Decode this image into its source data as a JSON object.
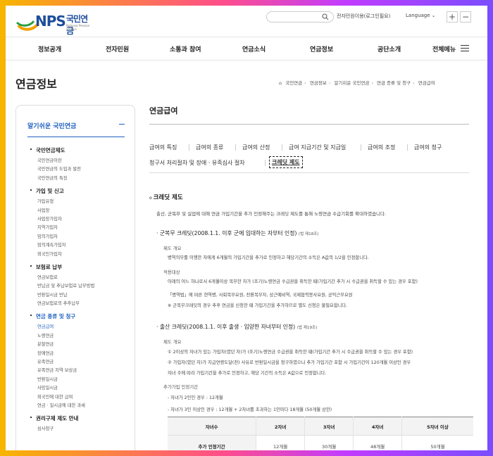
{
  "header": {
    "logo_mark": "NPS",
    "logo_ko": "국민연금",
    "logo_en": "National Pension Service",
    "search_placeholder": "",
    "util_link": "전자민원이용(로그인필요)",
    "language": "Language",
    "zoom_in": "+",
    "zoom_out": "−"
  },
  "gnb": [
    "정보공개",
    "전자민원",
    "소통과 참여",
    "연금소식",
    "연금정보",
    "공단소개",
    "전체메뉴"
  ],
  "page_title": "연금정보",
  "breadcrumb": [
    "국민연금",
    "연금정보",
    "알기쉬운 국민연금",
    "연금 종류 및 청구",
    "연금급여"
  ],
  "sidebar": {
    "head": "알기쉬운 국민연금",
    "groups": [
      {
        "label": "국민연금제도",
        "items": [
          "국민연금이란",
          "국민연금의 도입과 발전",
          "국민연금의 특징"
        ]
      },
      {
        "label": "가입 및 신고",
        "items": [
          "가입유형",
          "사업장",
          "사업장가입자",
          "지역가입자",
          "임의가입자",
          "임의계속가입자",
          "외국인가입자"
        ]
      },
      {
        "label": "보험료 납부",
        "items": [
          "연금보험료",
          "반납금 및 추납보험료 납부방법",
          "반환일시금 반납",
          "연금보험료의 추후납부"
        ]
      },
      {
        "label": "연금 종류 및 청구",
        "items": [
          "연금급여",
          "노령연금",
          "분할연금",
          "장애연금",
          "유족연금",
          "유족연금 지역 보상금",
          "반환일시금",
          "사망일시금",
          "외국인에 대한 급여",
          "연금 · 일시금에 대한 과세"
        ]
      },
      {
        "label": "권리구제 제도 안내",
        "items": [
          "심사청구"
        ]
      }
    ]
  },
  "content": {
    "title": "연금급여",
    "tabs": [
      "급여의 특징",
      "급여의 종류",
      "급여의 산정",
      "급여 지급기간 및 지급일",
      "급여의 조정",
      "급여의 청구",
      "청구서 처리절차 및 장애 · 유족심사 절차",
      "크레딧 제도"
    ],
    "section": "크레딧 제도",
    "lead": "출산, 군복무 및 실업에 대해 연금 가입기간을 추가 인정해주는 크레딧 제도를 통해 노령연금 수급기회를 확대하였습니다.",
    "military": {
      "title": "군복무 크레딧(2008.1.1. 이후 군에 입대하는 자부터 인정)",
      "law": "(법 제18조)",
      "overview_label": "제도 개요",
      "overview_text": "병역의무를 이행한 자에게 6개월의 가입기간을 추가로 인정하고 해당기간의 소득은 A값의 1/2을 인정합니다.",
      "target_label": "적용대상",
      "target_text": "아래의 어느 하나로서 6개월이상 복무한 자가 (조기)노령연금 수급권을 취득한 때(가입기간 추가 시 수급권을 취득할 수 있는 경우 포함)",
      "target_note1": "「병역법」에 따른 현역병, 사회복무요원, 전환복무자, 상근예비역, 국제협력봉사요원, 공익근무요원",
      "target_note2": "※ 군복무크레딧의 경우 추후 연금을 신청한 때 가입기간을 추가하므로 별도 신청은 불필요합니다."
    },
    "childbirth": {
      "title": "출산 크레딧(2008.1.1. 이후 출생 · 입양한 자녀부터 인정)",
      "law": "(법 제19조)",
      "overview_label": "제도 개요",
      "line1": "① 2이상의 자녀가 있는 가입자(였던 자)가 (조기)노령연금 수급권을 취득한 때(가입기간 추가 시 수급권을 취득할 수 있는 경우 포함)",
      "line2": "② 가입자(였던 자)가 지급연령도달(전) 사유로 반환일시금을 청구하였으나 추가 가입기간 포함 시 가입기간이 120개월 이상인 경우",
      "line3": "자녀 수에 따라 가입기간을 추가로 인정하고, 해당 기간의 소득은 A값으로 인정합니다.",
      "recognize_label": "추가가입 인정기간",
      "rule1": "자녀가 2인인 경우 : 12개월",
      "rule2": "자녀가 3인 이상인 경우 : 12개월 + 2자녀를 초과하는 1인마다 18개월 (50개월 상한)"
    },
    "table": {
      "headers": [
        "자녀수",
        "2자녀",
        "3자녀",
        "4자녀",
        "5자녀 이상"
      ],
      "row_label": "추가 인정기간",
      "row_values": [
        "12개월",
        "30개월",
        "48개월",
        "50개월"
      ]
    }
  }
}
